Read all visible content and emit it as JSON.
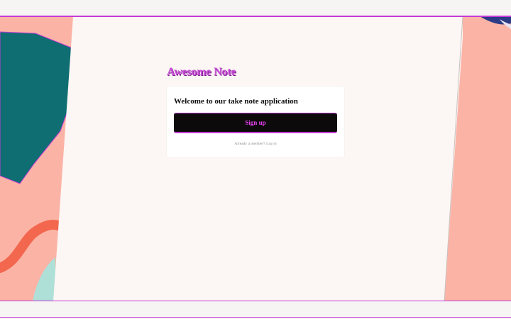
{
  "app": {
    "title": "Awesome Note"
  },
  "card": {
    "welcome": "Welcome to our take note application",
    "signup_label": "Sign up",
    "member_prompt": "Already a member?",
    "login_label": "Log in"
  },
  "colors": {
    "accent": "#c84bd8",
    "button_bg": "#0c0a0b",
    "background_pink": "#fbb3a6",
    "sheet": "#fcf6f4",
    "teal": "#0f6e72"
  }
}
